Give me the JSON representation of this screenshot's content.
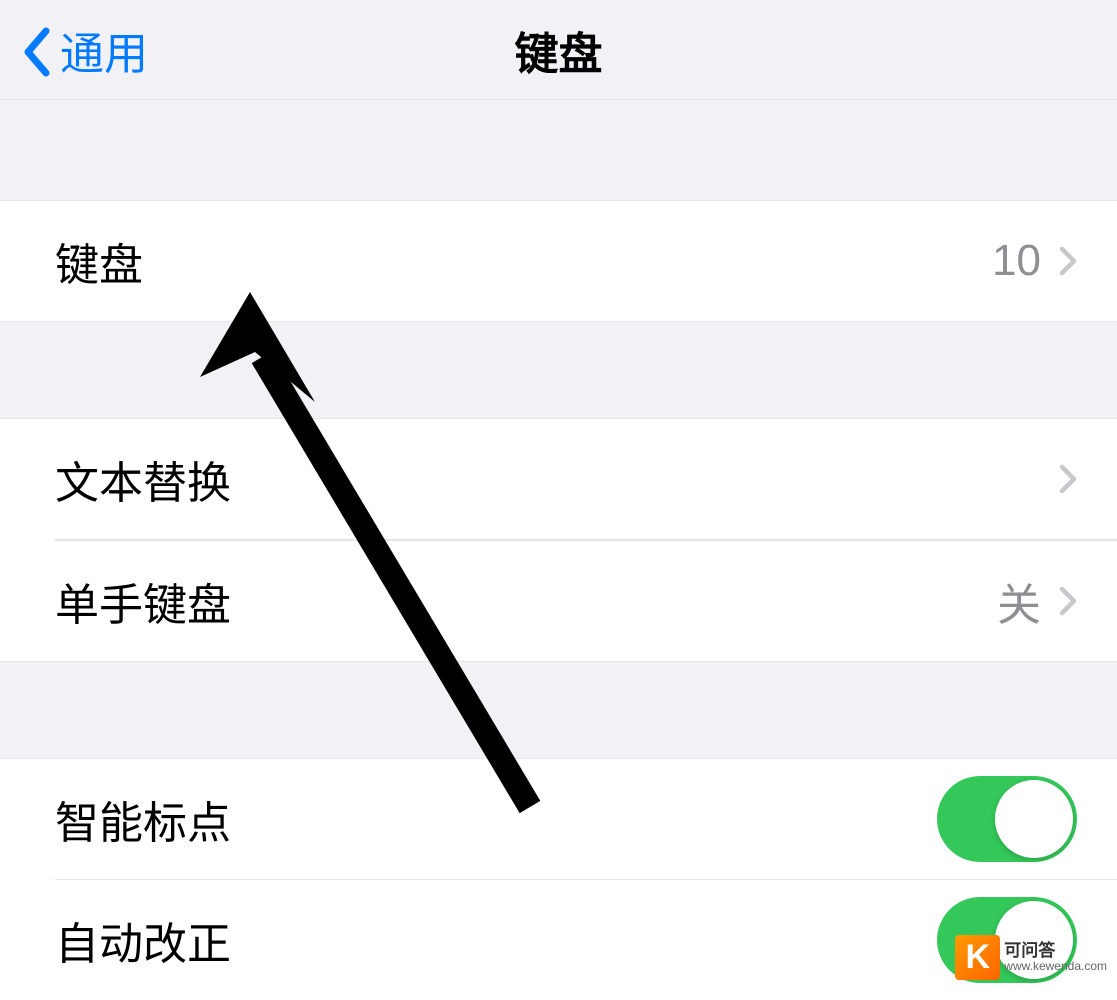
{
  "nav": {
    "back_label": "通用",
    "title": "键盘"
  },
  "rows": {
    "keyboards": {
      "label": "键盘",
      "value": "10"
    },
    "text_replacement": {
      "label": "文本替换"
    },
    "one_handed": {
      "label": "单手键盘",
      "value": "关"
    },
    "smart_punctuation": {
      "label": "智能标点",
      "on": true
    },
    "auto_correction": {
      "label": "自动改正",
      "on": true
    }
  },
  "watermark": {
    "logo_letter": "K",
    "title": "可问答",
    "url": "www.kewenda.com"
  }
}
